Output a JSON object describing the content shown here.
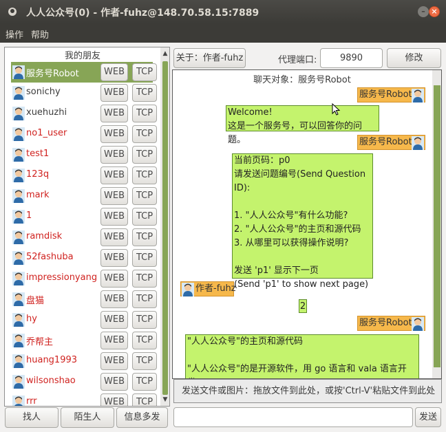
{
  "window": {
    "title": "人人公众号(0) - 作者-fuhz@148.70.58.15:7889",
    "minimize": "–",
    "close": "×"
  },
  "menu": {
    "items": [
      "操作",
      "帮助"
    ]
  },
  "friends": {
    "header": "我的朋友",
    "web_label": "WEB",
    "tcp_label": "TCP",
    "items": [
      {
        "name": "服务号Robot",
        "online": true,
        "selected": true
      },
      {
        "name": "sonichy",
        "online": true,
        "selected": false
      },
      {
        "name": "xuehuzhi",
        "online": true,
        "selected": false
      },
      {
        "name": "no1_user",
        "online": false,
        "selected": false
      },
      {
        "name": "test1",
        "online": false,
        "selected": false
      },
      {
        "name": "123q",
        "online": false,
        "selected": false
      },
      {
        "name": "mark",
        "online": false,
        "selected": false
      },
      {
        "name": "1",
        "online": false,
        "selected": false
      },
      {
        "name": "ramdisk",
        "online": false,
        "selected": false
      },
      {
        "name": "52fashuba",
        "online": false,
        "selected": false
      },
      {
        "name": "impressionyang",
        "online": false,
        "selected": false
      },
      {
        "name": "盘猫",
        "online": false,
        "selected": false
      },
      {
        "name": "hy",
        "online": false,
        "selected": false
      },
      {
        "name": "乔帮主",
        "online": false,
        "selected": false
      },
      {
        "name": "huang1993",
        "online": false,
        "selected": false
      },
      {
        "name": "wilsonshao",
        "online": false,
        "selected": false
      },
      {
        "name": "rrr",
        "online": false,
        "selected": false
      }
    ]
  },
  "bottom_buttons": {
    "find": "找人",
    "stranger": "陌生人",
    "broadcast": "信息多发"
  },
  "top": {
    "about": "关于：作者-fuhz",
    "proxy_label": "代理端口:",
    "proxy_port": "9890",
    "modify": "修改"
  },
  "chat": {
    "target": "聊天对象：服务号Robot",
    "robot_name": "服务号Robot",
    "me_name": "作者-fuhz",
    "msg1": "Welcome!\n这是一个服务号，可以回答你的问题。",
    "msg2": "当前页码：p0\n请发送问题编号(Send Question ID):\n\n1. \"人人公众号\"有什么功能?\n2. \"人人公众号\"的主页和源代码\n3. 从哪里可以获得操作说明?\n\n发送 'p1' 显示下一页\n(Send 'p1' to show next page)",
    "msg3": "2",
    "msg4": "\"人人公众号\"的主页和源代码\n\n\"人人公众号\"的是开源软件，用 go 语言和 vala 语言开发。\n它的主页在:"
  },
  "send": {
    "hint": "发送文件或图片：拖放文件到此处，或按'Ctrl-V'粘贴文件到此处",
    "button": "发送"
  },
  "colors": {
    "selected_row": "#87a556",
    "offline_name": "#d0221f",
    "message_bg": "#c4f36d",
    "sender_tag": "#f6b84b",
    "titlebar": "#3c3b37"
  }
}
